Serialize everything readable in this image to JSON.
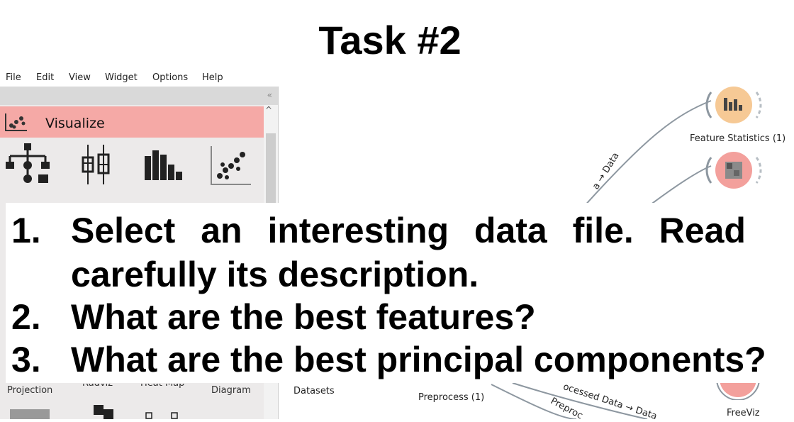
{
  "slide": {
    "title": "Task #2"
  },
  "menu": [
    "File",
    "Edit",
    "View",
    "Widget",
    "Options",
    "Help"
  ],
  "toolbox": {
    "collapse_glyph": "«",
    "scroll_up_glyph": "^",
    "category": "Visualize",
    "bottom_labels": [
      "Projection",
      "Radviz",
      "Heat Map",
      "Diagram"
    ]
  },
  "canvas": {
    "feature_statistics_label": "Feature Statistics (1)",
    "link_top": "a → Data",
    "datasets_label": "Datasets",
    "preprocess_label": "Preprocess (1)",
    "link_bottom1": "ocessed Data → Data",
    "link_bottom2": "Preproc",
    "freeviz_label": "FreeViz",
    "freeviz_glyph": "⟵"
  },
  "tasks": [
    {
      "num": "1.",
      "line1": "Select  an interesting data file. Read",
      "line2": "carefully its description."
    },
    {
      "num": "2.",
      "line1": "What are the best features?"
    },
    {
      "num": "3.",
      "line1": "What are the best principal components?"
    }
  ],
  "colors": {
    "visualize_bar": "#f5a9a6",
    "node_orange": "#f6c995",
    "node_red": "#f3a09c"
  }
}
